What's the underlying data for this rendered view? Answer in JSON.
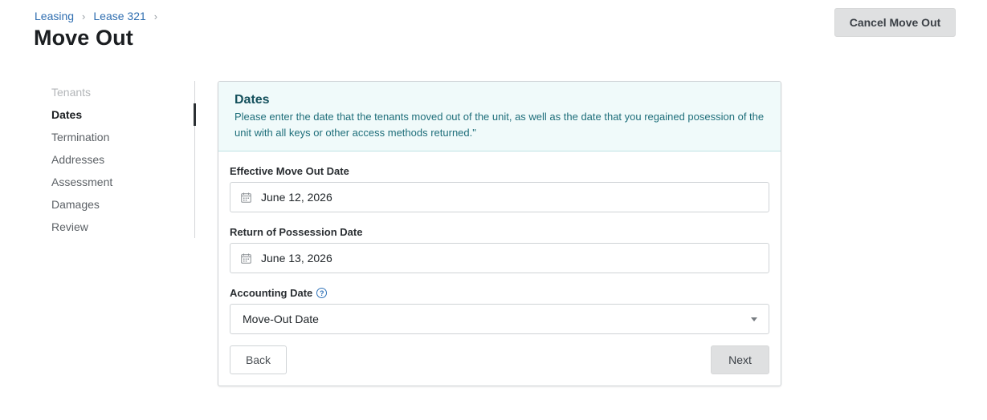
{
  "breadcrumb": {
    "items": [
      "Leasing",
      "Lease 321"
    ],
    "separator_icon": "chevron-right-icon"
  },
  "page": {
    "title": "Move Out"
  },
  "header_actions": {
    "cancel_label": "Cancel Move Out"
  },
  "steps": {
    "items": [
      "Tenants",
      "Dates",
      "Termination",
      "Addresses",
      "Assessment",
      "Damages",
      "Review"
    ],
    "active": "Dates",
    "disabled": [
      "Tenants"
    ]
  },
  "info": {
    "title": "Dates",
    "text": "Please enter the date that the tenants moved out of the unit, as well as the date that you regained posession of the unit with all keys or other access methods returned.\""
  },
  "form": {
    "move_out_label": "Effective Move Out Date",
    "move_out_value": "June 12, 2026",
    "possession_label": "Return of Possession Date",
    "possession_value": "June 13, 2026",
    "accounting_label": "Accounting Date",
    "accounting_help_icon": "question-circle-icon",
    "accounting_help_glyph": "?",
    "accounting_value": "Move-Out Date",
    "date_icon": "calendar-icon"
  },
  "footer": {
    "back_label": "Back",
    "next_label": "Next"
  },
  "colors": {
    "link": "#2f6eb0",
    "info_background": "#f0fafa",
    "info_title": "#14505c",
    "info_text": "#1e6e7a",
    "button_gray": "#dfe0e1"
  }
}
